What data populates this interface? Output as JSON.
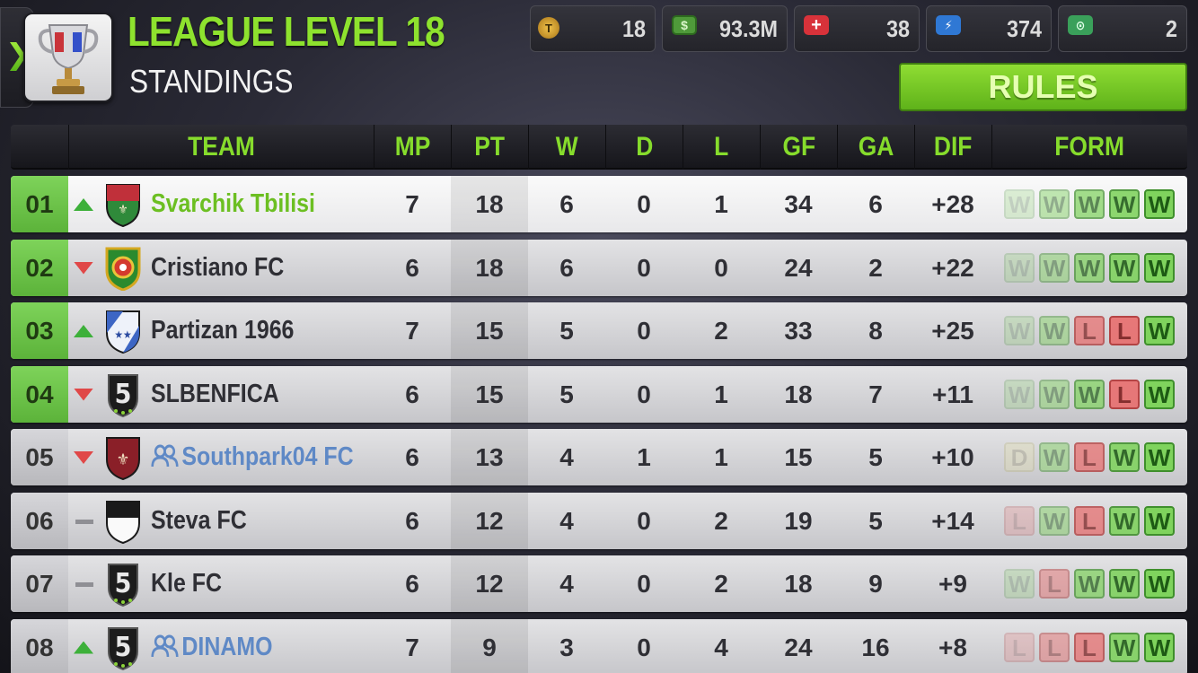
{
  "header": {
    "title": "LEAGUE LEVEL 18",
    "subtitle": "STANDINGS",
    "rules_label": "RULES"
  },
  "resources": [
    {
      "icon": "token-icon",
      "value": "18"
    },
    {
      "icon": "cash-icon",
      "value": "93.3M"
    },
    {
      "icon": "health-pack-icon",
      "value": "38"
    },
    {
      "icon": "energy-icon",
      "value": "374"
    },
    {
      "icon": "scout-ticket-icon",
      "value": "2"
    }
  ],
  "columns": [
    "TEAM",
    "MP",
    "PT",
    "W",
    "D",
    "L",
    "GF",
    "GA",
    "DIF",
    "FORM"
  ],
  "rows": [
    {
      "pos": "01",
      "trend": "up",
      "team": "Svarchik Tbilisi",
      "kind": "me",
      "crest": "red-green",
      "mp": "7",
      "pt": "18",
      "w": "6",
      "d": "0",
      "l": "1",
      "gf": "34",
      "ga": "6",
      "dif": "+28",
      "form": [
        "W",
        "W",
        "W",
        "W",
        "W"
      ]
    },
    {
      "pos": "02",
      "trend": "down",
      "team": "Cristiano FC",
      "kind": "normal",
      "crest": "portugal",
      "mp": "6",
      "pt": "18",
      "w": "6",
      "d": "0",
      "l": "0",
      "gf": "24",
      "ga": "2",
      "dif": "+22",
      "form": [
        "W",
        "W",
        "W",
        "W",
        "W"
      ]
    },
    {
      "pos": "03",
      "trend": "up",
      "team": "Partizan 1966",
      "kind": "normal",
      "crest": "blue-stars",
      "mp": "7",
      "pt": "15",
      "w": "5",
      "d": "0",
      "l": "2",
      "gf": "33",
      "ga": "8",
      "dif": "+25",
      "form": [
        "W",
        "W",
        "L",
        "L",
        "W"
      ]
    },
    {
      "pos": "04",
      "trend": "down",
      "team": "SLBENFICA",
      "kind": "normal",
      "crest": "five-black",
      "mp": "6",
      "pt": "15",
      "w": "5",
      "d": "0",
      "l": "1",
      "gf": "18",
      "ga": "7",
      "dif": "+11",
      "form": [
        "W",
        "W",
        "W",
        "L",
        "W"
      ]
    },
    {
      "pos": "05",
      "trend": "down",
      "team": "Southpark04 FC",
      "kind": "friend",
      "crest": "dark-red",
      "mp": "6",
      "pt": "13",
      "w": "4",
      "d": "1",
      "l": "1",
      "gf": "15",
      "ga": "5",
      "dif": "+10",
      "form": [
        "D",
        "W",
        "L",
        "W",
        "W"
      ]
    },
    {
      "pos": "06",
      "trend": "same",
      "team": "Steva FC",
      "kind": "normal",
      "crest": "black-white",
      "mp": "6",
      "pt": "12",
      "w": "4",
      "d": "0",
      "l": "2",
      "gf": "19",
      "ga": "5",
      "dif": "+14",
      "form": [
        "L",
        "W",
        "L",
        "W",
        "W"
      ]
    },
    {
      "pos": "07",
      "trend": "same",
      "team": "Kle FC",
      "kind": "normal",
      "crest": "five-black",
      "mp": "6",
      "pt": "12",
      "w": "4",
      "d": "0",
      "l": "2",
      "gf": "18",
      "ga": "9",
      "dif": "+9",
      "form": [
        "W",
        "L",
        "W",
        "W",
        "W"
      ]
    },
    {
      "pos": "08",
      "trend": "up",
      "team": "DINAMO",
      "kind": "friend",
      "crest": "five-black",
      "mp": "7",
      "pt": "9",
      "w": "3",
      "d": "0",
      "l": "4",
      "gf": "24",
      "ga": "16",
      "dif": "+8",
      "form": [
        "L",
        "L",
        "L",
        "W",
        "W"
      ]
    }
  ]
}
